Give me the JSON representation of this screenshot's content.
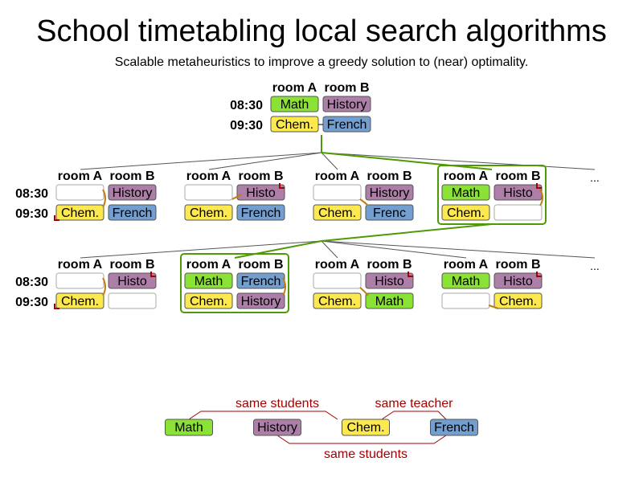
{
  "title": "School timetabling local search algorithms",
  "subtitle": "Scalable metaheuristics to improve a greedy solution to (near) optimality.",
  "rooms": [
    "room A",
    "room B"
  ],
  "times": [
    "08:30",
    "09:30"
  ],
  "ellipsis": "...",
  "lessons": {
    "math": "Math",
    "history": "History",
    "chem": "Chem.",
    "french": "French",
    "history_partial": "Histo",
    "french_partial": "Frenc"
  },
  "colors": {
    "math": "#8ae234",
    "history": "#ad7fa8",
    "chem": "#fce94f",
    "french": "#729fcf",
    "empty": "#ffffff",
    "tree_line": "#555555",
    "selected": "#4e9a06",
    "constraint": "#a40000",
    "move_arrow": "#c17d11"
  },
  "constraints": {
    "items": [
      "Math",
      "History",
      "Chem.",
      "French"
    ],
    "labels": [
      "same students",
      "same teacher",
      "same students"
    ]
  }
}
